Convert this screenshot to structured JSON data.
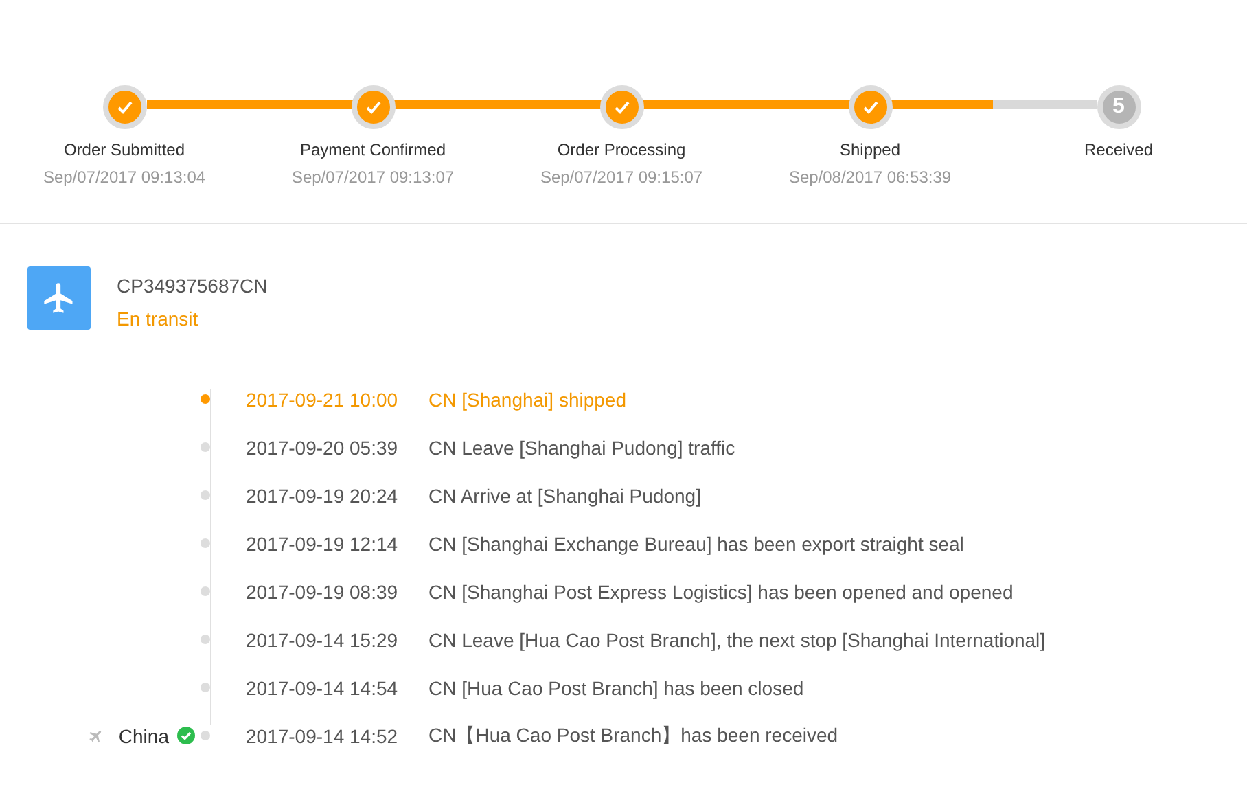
{
  "progress": {
    "level": 0.89
  },
  "steps": [
    {
      "label": "Order Submitted",
      "time": "Sep/07/2017 09:13:04",
      "done": true
    },
    {
      "label": "Payment Confirmed",
      "time": "Sep/07/2017 09:13:07",
      "done": true
    },
    {
      "label": "Order Processing",
      "time": "Sep/07/2017 09:15:07",
      "done": true
    },
    {
      "label": "Shipped",
      "time": "Sep/08/2017 06:53:39",
      "done": true
    },
    {
      "label": "Received",
      "number": "5",
      "done": false
    }
  ],
  "shipment": {
    "tracking_number": "CP349375687CN",
    "status": "En transit"
  },
  "events": [
    {
      "time": "2017-09-21 10:00",
      "text": "CN [Shanghai] shipped",
      "current": true
    },
    {
      "time": "2017-09-20 05:39",
      "text": "CN Leave [Shanghai Pudong] traffic",
      "current": false
    },
    {
      "time": "2017-09-19 20:24",
      "text": "CN Arrive at [Shanghai Pudong]",
      "current": false
    },
    {
      "time": "2017-09-19 12:14",
      "text": "CN [Shanghai Exchange Bureau] has been export straight seal",
      "current": false
    },
    {
      "time": "2017-09-19 08:39",
      "text": "CN [Shanghai Post Express Logistics] has been opened and opened",
      "current": false
    },
    {
      "time": "2017-09-14 15:29",
      "text": "CN Leave [Hua Cao Post Branch], the next stop [Shanghai International]",
      "current": false
    },
    {
      "time": "2017-09-14 14:54",
      "text": "CN [Hua Cao Post Branch] has been closed",
      "current": false
    },
    {
      "time": "2017-09-14 14:52",
      "text": "CN【Hua Cao Post Branch】has been received",
      "current": false,
      "origin": {
        "label": "China",
        "verified": true
      }
    }
  ]
}
